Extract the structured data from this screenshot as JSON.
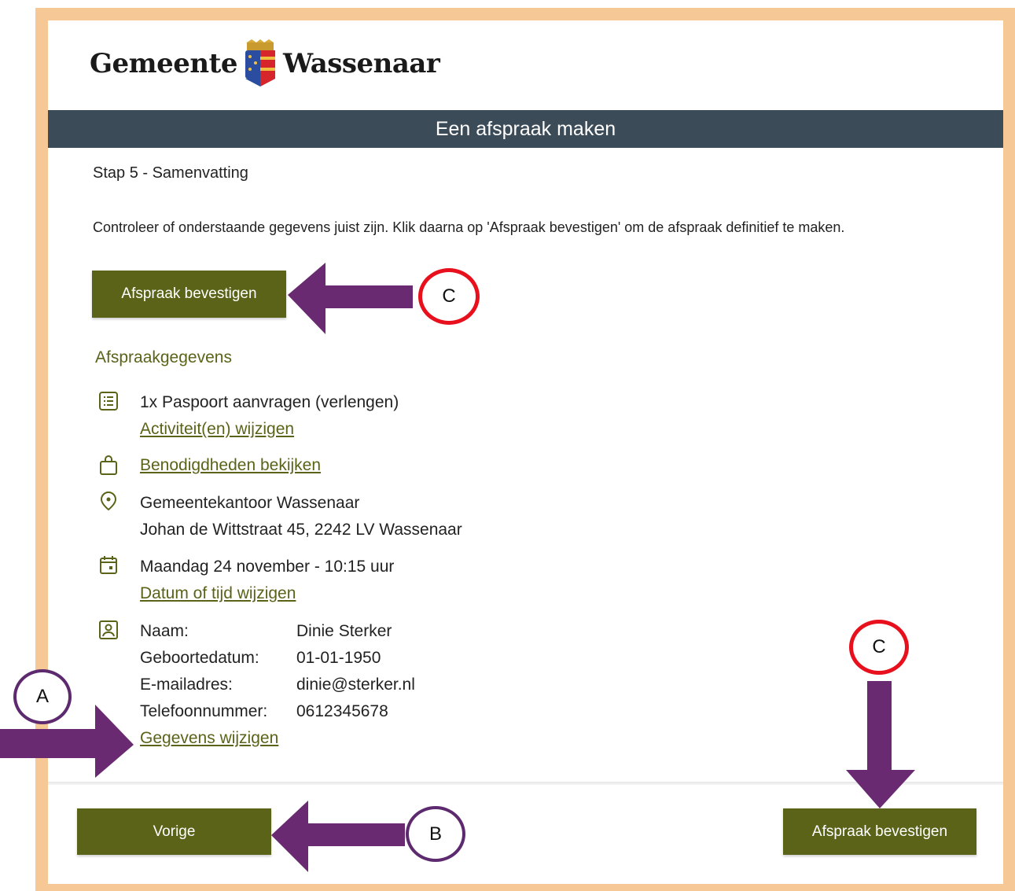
{
  "header": {
    "logo_left": "Gemeente",
    "logo_right": "Wassenaar",
    "bar_title": "Een afspraak maken"
  },
  "step": {
    "title": "Stap 5 - Samenvatting",
    "instructions": "Controleer of onderstaande gegevens juist zijn. Klik daarna op 'Afspraak bevestigen' om de afspraak definitief te maken."
  },
  "buttons": {
    "confirm_top": "Afspraak bevestigen",
    "previous": "Vorige",
    "confirm_bottom": "Afspraak bevestigen"
  },
  "summary": {
    "heading": "Afspraakgegevens",
    "activity": "1x Paspoort aanvragen (verlengen)",
    "activity_link": "Activiteit(en) wijzigen",
    "requirements_link": "Benodigdheden bekijken",
    "location_name": "Gemeentekantoor Wassenaar",
    "location_address": "Johan de Wittstraat 45, 2242 LV Wassenaar",
    "datetime": "Maandag 24 november - 10:15 uur",
    "datetime_link": "Datum of tijd wijzigen",
    "personal": [
      {
        "label": "Naam:",
        "value": "Dinie Sterker"
      },
      {
        "label": "Geboortedatum:",
        "value": "01-01-1950"
      },
      {
        "label": "E-mailadres:",
        "value": "dinie@sterker.nl"
      },
      {
        "label": "Telefoonnummer:",
        "value": "0612345678"
      }
    ],
    "personal_link": "Gegevens wijzigen"
  },
  "annotations": {
    "badge_c_top": "C",
    "badge_c_right": "C",
    "badge_a": "A",
    "badge_b": "B",
    "arrow_color": "#6a2a72",
    "red_ring_color": "#e8101c",
    "purple_ring_color": "#5e2a6f"
  },
  "colors": {
    "brand_green": "#5b6318",
    "header_bar": "#3b4b58",
    "frame": "#f5c896"
  },
  "icons": [
    "list-icon",
    "bag-icon",
    "location-pin-icon",
    "calendar-icon",
    "contact-icon"
  ]
}
